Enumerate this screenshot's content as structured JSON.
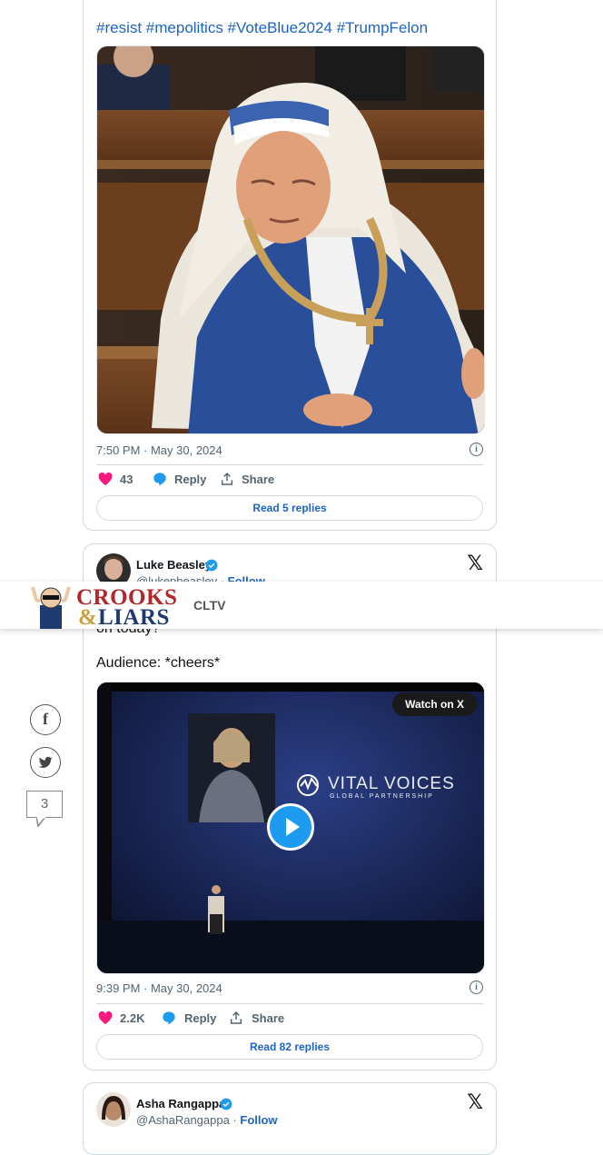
{
  "tweet1": {
    "hashtags": "#resist #mepolitics #VoteBlue2024 #TrumpFelon",
    "timestamp": "7:50 PM · May 30, 2024",
    "likes": "43",
    "reply_label": "Reply",
    "share_label": "Share",
    "read_replies": "Read 5 replies"
  },
  "tweet2": {
    "author_name": "Luke Beasley",
    "handle": "@lukepbeasley",
    "follow": "Follow",
    "partial_text": "on today?",
    "text": "Audience: *cheers*",
    "watch_on_x": "Watch on X",
    "video_brand_main": "VITAL VOICES",
    "video_brand_sub": "GLOBAL PARTNERSHIP",
    "timestamp": "9:39 PM · May 30, 2024",
    "likes": "2.2K",
    "reply_label": "Reply",
    "share_label": "Share",
    "read_replies": "Read 82 replies"
  },
  "tweet3": {
    "author_name": "Asha Rangappa",
    "handle": "@AshaRangappa",
    "follow": "Follow"
  },
  "site_header": {
    "logo_line1": "CROOKS",
    "logo_amp": "&",
    "logo_line2": "LIARS",
    "section": "CLTV"
  },
  "share_rail": {
    "comment_count": "3"
  },
  "colors": {
    "link_blue": "#1d64c4",
    "heart": "#f91880",
    "reply_bubble": "#1d9bf0",
    "logo_red": "#b3272a",
    "logo_navy": "#1f3a6e"
  }
}
